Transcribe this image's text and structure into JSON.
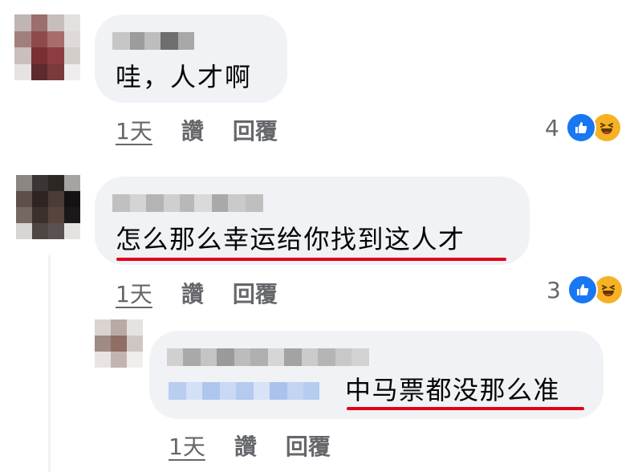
{
  "comments": [
    {
      "text": "哇，人才啊",
      "time": "1天",
      "like_label": "讚",
      "reply_label": "回覆",
      "reaction_count": "4",
      "reactions": [
        "like-icon",
        "haha-icon"
      ]
    },
    {
      "text": "怎么那么幸运给你找到这人才",
      "time": "1天",
      "like_label": "讚",
      "reply_label": "回覆",
      "reaction_count": "3",
      "reactions": [
        "like-icon",
        "haha-icon"
      ],
      "underline_color": "#e0001b"
    },
    {
      "text": "中马票都没那么准",
      "time": "1天",
      "like_label": "讚",
      "reply_label": "回覆",
      "underline_color": "#e0001b",
      "is_reply": true
    }
  ],
  "colors": {
    "bubble_bg": "#f0f2f5",
    "text": "#050505",
    "meta": "#65676b",
    "like_blue": "#1877f2",
    "haha_yellow": "#f7b125",
    "underline_red": "#e0001b"
  }
}
